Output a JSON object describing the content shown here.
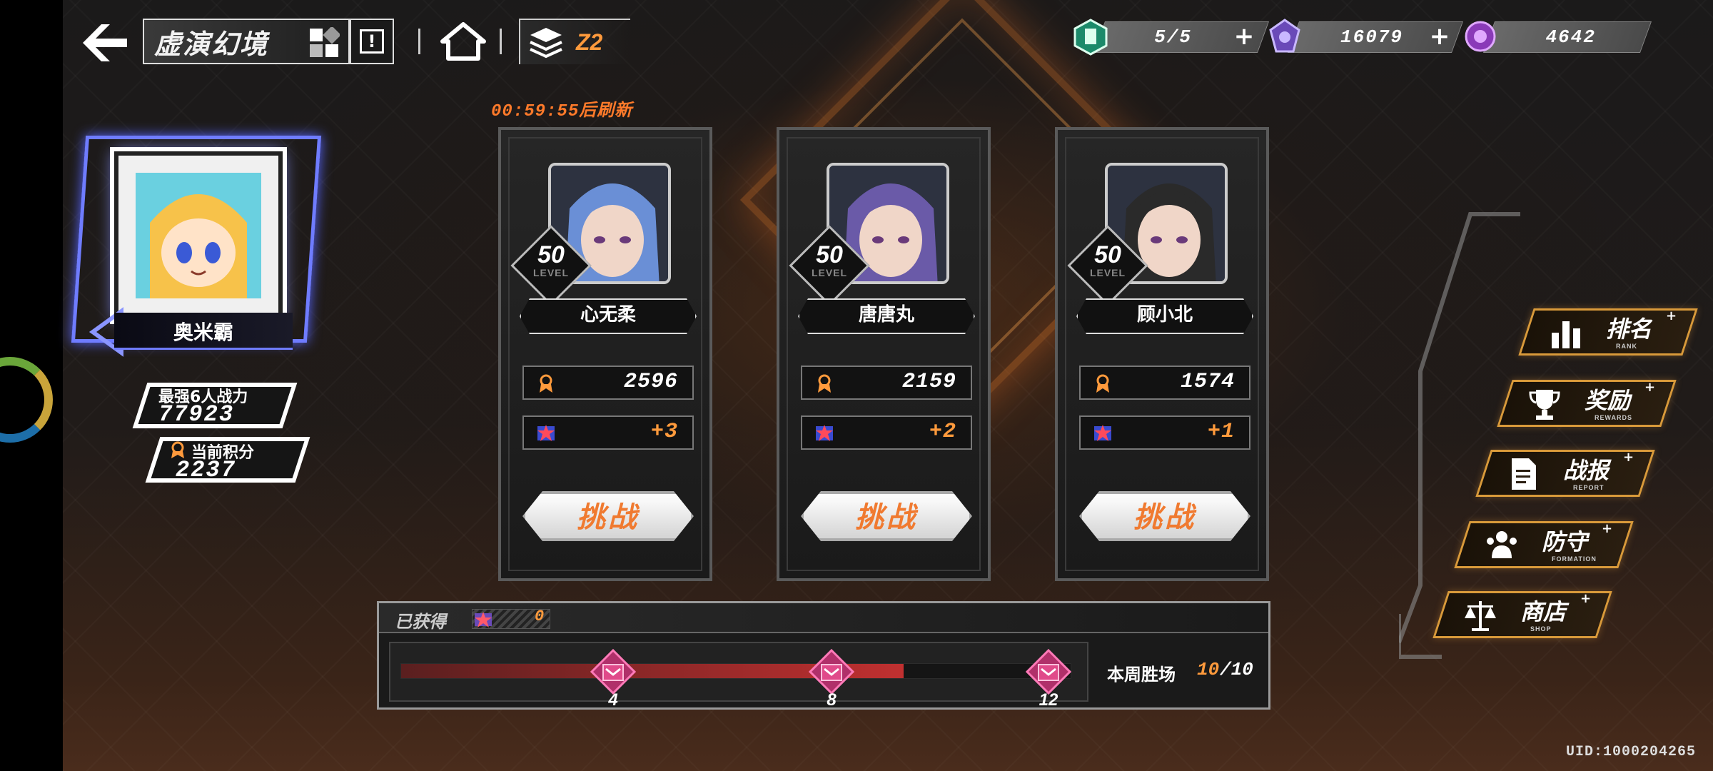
{
  "header": {
    "title": "虚演幻境",
    "layer": "Z2",
    "resources": [
      {
        "icon": "stamina-icon",
        "value": "5/5",
        "has_plus": true
      },
      {
        "icon": "crystal-icon",
        "value": "16079",
        "has_plus": true
      },
      {
        "icon": "token-icon",
        "value": "4642",
        "has_plus": false
      }
    ]
  },
  "refresh_timer": "00:59:55后刷新",
  "player": {
    "name": "奥米霸",
    "power_label": "最强6人战力",
    "power_value": "77923",
    "score_label": "当前积分",
    "score_value": "2237"
  },
  "opponents": [
    {
      "name": "心无柔",
      "level": "50",
      "level_label": "LEVEL",
      "score": "2596",
      "bonus": "+3",
      "button": "挑战",
      "hair": "#6a8fd6"
    },
    {
      "name": "唐唐丸",
      "level": "50",
      "level_label": "LEVEL",
      "score": "2159",
      "bonus": "+2",
      "button": "挑战",
      "hair": "#6a5aa8"
    },
    {
      "name": "顾小北",
      "level": "50",
      "level_label": "LEVEL",
      "score": "1574",
      "bonus": "+1",
      "button": "挑战",
      "hair": "#2a2a2a"
    }
  ],
  "progress": {
    "obtained_label": "已获得",
    "obtained_value": "0",
    "milestones": [
      "4",
      "8",
      "12"
    ],
    "weekly_label": "本周胜场",
    "weekly_current": "10",
    "weekly_total": "/10",
    "fill_fraction": 0.75
  },
  "menu": [
    {
      "label": "排名",
      "sub": "RANK",
      "icon": "bar-chart-icon"
    },
    {
      "label": "奖励",
      "sub": "REWARDS",
      "icon": "trophy-icon"
    },
    {
      "label": "战报",
      "sub": "REPORT",
      "icon": "document-icon"
    },
    {
      "label": "防守",
      "sub": "FORMATION",
      "icon": "team-icon"
    },
    {
      "label": "商店",
      "sub": "SHOP",
      "icon": "scale-icon"
    }
  ],
  "uid": "UID:1000204265",
  "colors": {
    "accent": "#ff9a3c",
    "profile_glow": "#6f7cff",
    "menu_border": "#d99a3a"
  }
}
